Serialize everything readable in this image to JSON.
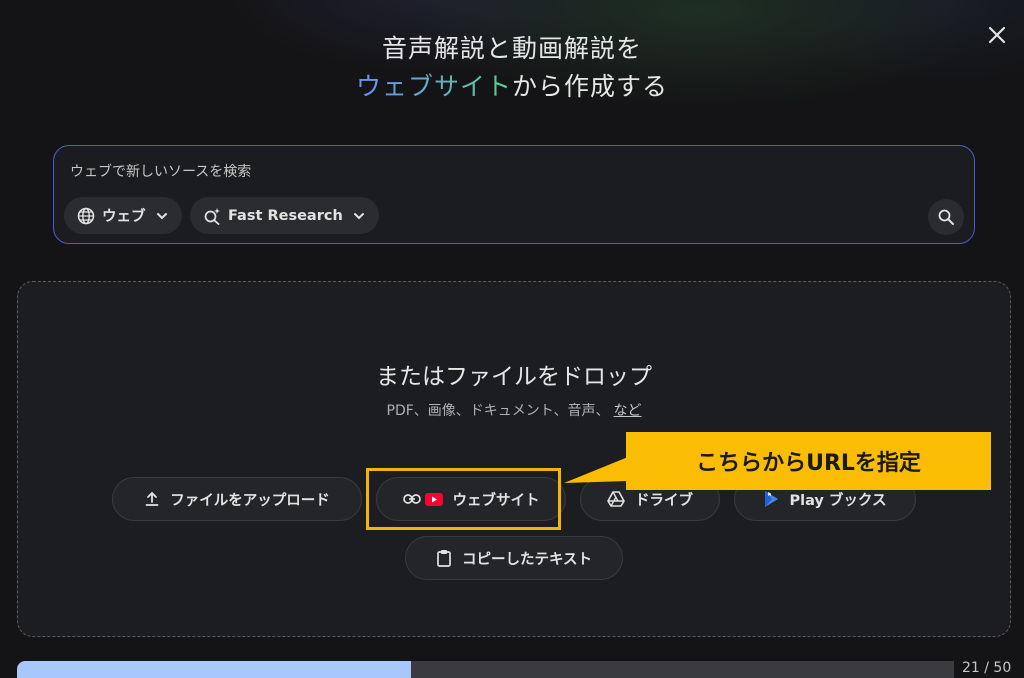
{
  "dialog": {
    "title_line1": "音声解説と動画解説を",
    "title_accent": "ウェブサイト",
    "title_line2_rest": "から作成する"
  },
  "search": {
    "placeholder": "ウェブで新しいソースを検索",
    "source_chip_label": "ウェブ",
    "mode_chip_label": "Fast Research"
  },
  "dropzone": {
    "title": "またはファイルをドロップ",
    "subtitle": "PDF、画像、ドキュメント、音声、",
    "more_link": "など"
  },
  "upload_options": {
    "file_upload": "ファイルをアップロード",
    "website": "ウェブサイト",
    "drive": "ドライブ",
    "play_books": "Play ブックス",
    "copied_text": "コピーしたテキスト"
  },
  "annotation": {
    "callout_text": "こちらからURLを指定"
  },
  "progress": {
    "current": 21,
    "total": 50,
    "fraction": 0.42,
    "label": "21 / 50"
  },
  "colors": {
    "accent_border": "#4b5bd6",
    "highlight": "#fbbc04",
    "progress_fill": "#a8c7fa"
  },
  "icons": [
    "close-icon",
    "globe-icon",
    "chevron-down-icon",
    "sparkle-search-icon",
    "search-icon",
    "upload-icon",
    "link-icon",
    "youtube-icon",
    "drive-icon",
    "play-books-icon",
    "clipboard-icon"
  ]
}
